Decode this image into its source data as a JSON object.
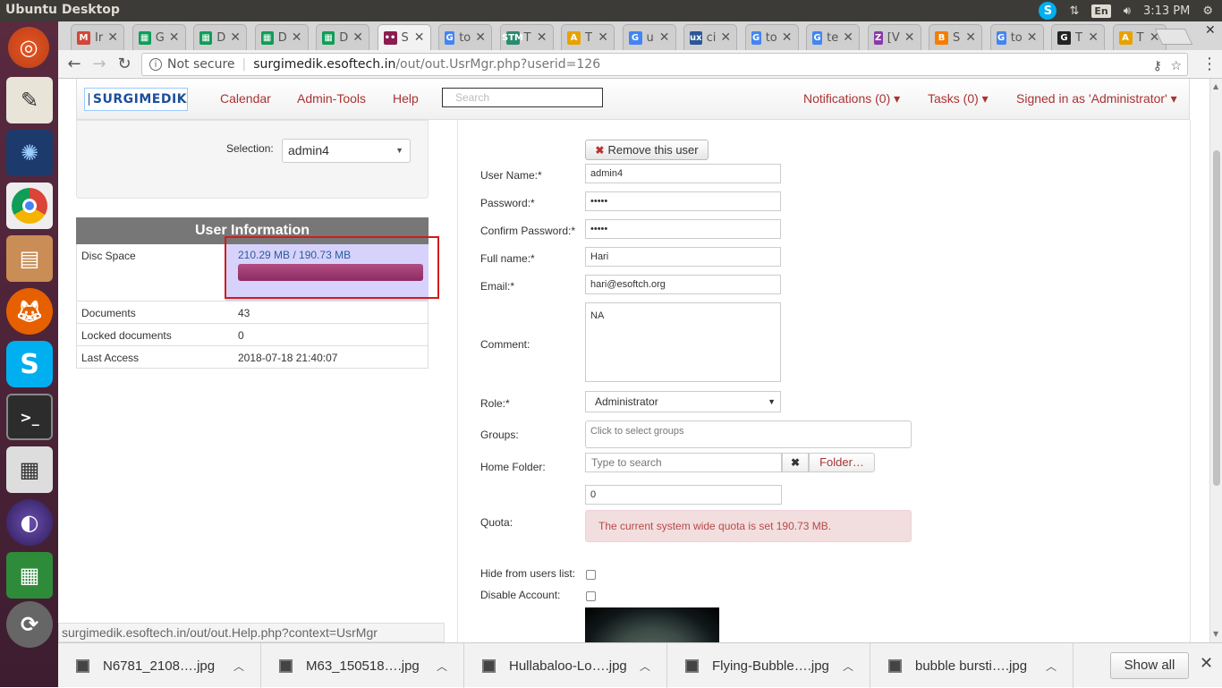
{
  "desktop": {
    "title": "Ubuntu Desktop",
    "tray": {
      "lang": "En",
      "clock": "3:13 PM"
    }
  },
  "tabs": [
    {
      "letter": "Ir",
      "color": "#d44638",
      "icon": "M"
    },
    {
      "letter": "G",
      "color": "#0f9d58",
      "icon": "▦"
    },
    {
      "letter": "D",
      "color": "#0f9d58",
      "icon": "▦"
    },
    {
      "letter": "D",
      "color": "#0f9d58",
      "icon": "▦"
    },
    {
      "letter": "D",
      "color": "#0f9d58",
      "icon": "▦"
    },
    {
      "letter": "S",
      "color": "#8b1d4f",
      "icon": "••"
    },
    {
      "letter": "to",
      "color": "#4285f4",
      "icon": "G"
    },
    {
      "letter": "T",
      "color": "#2a8c6e",
      "icon": "STM"
    },
    {
      "letter": "T",
      "color": "#e8a200",
      "icon": "A"
    },
    {
      "letter": "u",
      "color": "#4285f4",
      "icon": "G"
    },
    {
      "letter": "ci",
      "color": "#2b5797",
      "icon": "ux"
    },
    {
      "letter": "to",
      "color": "#4285f4",
      "icon": "G"
    },
    {
      "letter": "te",
      "color": "#4285f4",
      "icon": "G"
    },
    {
      "letter": "[V",
      "color": "#8a3aa8",
      "icon": "Z"
    },
    {
      "letter": "S",
      "color": "#f57d00",
      "icon": "B"
    },
    {
      "letter": "to",
      "color": "#4285f4",
      "icon": "G"
    },
    {
      "letter": "T",
      "color": "#222222",
      "icon": "G"
    },
    {
      "letter": "T",
      "color": "#e8a200",
      "icon": "A"
    }
  ],
  "address": {
    "not_secure": "Not secure",
    "host": "surgimedik.esoftech.in",
    "path": "/out/out.UsrMgr.php?userid=126"
  },
  "app": {
    "logo": "SURGIMEDIK",
    "nav": {
      "calendar": "Calendar",
      "admin_tools": "Admin-Tools",
      "help": "Help",
      "search_placeholder": "Search",
      "notifications": "Notifications (0) ▾",
      "tasks": "Tasks (0) ▾",
      "signed_in": "Signed in as 'Administrator' ▾"
    },
    "selection": {
      "label": "Selection:",
      "value": "admin4"
    },
    "user_info": {
      "title": "User Information",
      "disc_space_label": "Disc Space",
      "disc_space_value": "210.29 MB / 190.73 MB",
      "disc_usage_fraction": 1.0,
      "documents_label": "Documents",
      "documents_value": "43",
      "locked_label": "Locked documents",
      "locked_value": "0",
      "last_access_label": "Last Access",
      "last_access_value": "2018-07-18 21:40:07"
    },
    "form": {
      "remove_user": "Remove this user",
      "username_label": "User Name:*",
      "username_value": "admin4",
      "password_label": "Password:*",
      "password_value": "•••••",
      "confirm_label": "Confirm Password:*",
      "confirm_value": "•••••",
      "fullname_label": "Full name:*",
      "fullname_value": "Hari",
      "email_label": "Email:*",
      "email_value": "hari@esoftch.org",
      "comment_label": "Comment:",
      "comment_value": "NA",
      "role_label": "Role:*",
      "role_value": "Administrator",
      "groups_label": "Groups:",
      "groups_placeholder": "Click to select groups",
      "home_folder_label": "Home Folder:",
      "home_folder_placeholder": "Type to search",
      "folder_button": "Folder…",
      "quota_value": "0",
      "quota_label": "Quota:",
      "quota_alert": "The current system wide quota is set 190.73 MB.",
      "hide_label": "Hide from users list:",
      "disable_label": "Disable Account:"
    }
  },
  "status_url": "surgimedik.esoftech.in/out/out.Help.php?context=UsrMgr",
  "downloads": {
    "items": [
      "N6781_2108….jpg",
      "M63_150518….jpg",
      "Hullabaloo-Lo….jpg",
      "Flying-Bubble….jpg",
      "bubble bursti….jpg"
    ],
    "show_all": "Show all"
  }
}
